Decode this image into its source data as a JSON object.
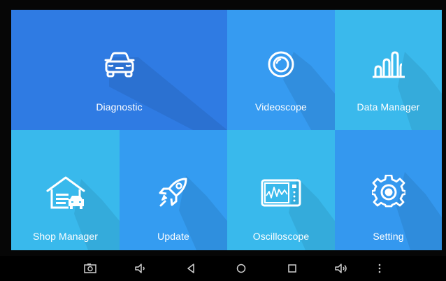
{
  "tiles": {
    "diagnostic": {
      "label": "Diagnostic",
      "icon": "car-icon"
    },
    "videoscope": {
      "label": "Videoscope",
      "icon": "camera-lens-icon"
    },
    "data_manager": {
      "label": "Data Manager",
      "icon": "bar-chart-icon"
    },
    "shop_manager": {
      "label": "Shop Manager",
      "icon": "garage-icon"
    },
    "update": {
      "label": "Update",
      "icon": "rocket-icon"
    },
    "oscilloscope": {
      "label": "Oscilloscope",
      "icon": "oscilloscope-icon"
    },
    "setting": {
      "label": "Setting",
      "icon": "gear-icon"
    }
  },
  "navbar": {
    "buttons": [
      "screenshot-icon",
      "volume-down-icon",
      "back-icon",
      "home-icon",
      "recents-icon",
      "volume-up-icon",
      "more-icon"
    ]
  },
  "colors": {
    "diagnostic": "#2f7be3",
    "videoscope": "#369bf1",
    "data_manager": "#3ab9ec",
    "shop_manager": "#39b9ec",
    "update": "#349cf1",
    "oscilloscope": "#39b9ec",
    "setting": "#3498ef"
  }
}
